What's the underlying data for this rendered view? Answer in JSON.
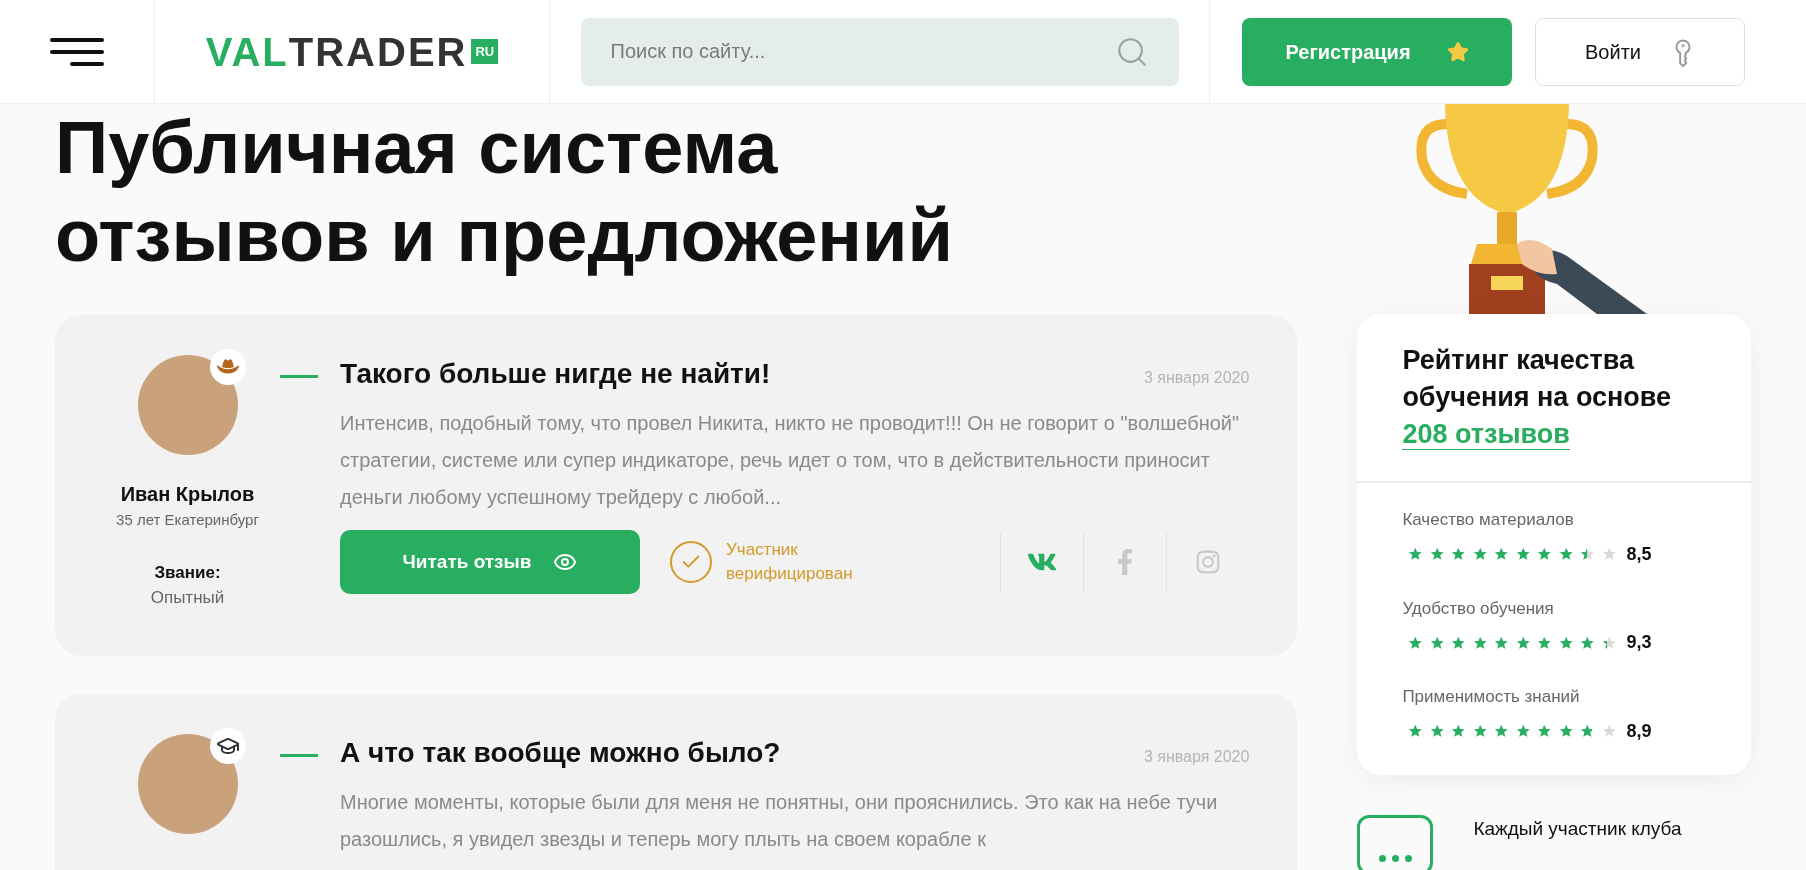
{
  "header": {
    "logo": {
      "part_1": "VAL",
      "part_2": "TRADER",
      "badge": "RU"
    },
    "search": {
      "placeholder": "Поиск по сайту..."
    },
    "register_button": "Регистрация",
    "login_button": "Войти"
  },
  "page_title": "Публичная система отзывов и предложений",
  "reviews": [
    {
      "author": "Иван Крылов",
      "meta": "35 лет Екатеринбург",
      "rank_label": "Звание:",
      "rank": "Опытный",
      "badge": {
        "kind": "hat"
      },
      "title": "Такого больше нигде не найти!",
      "date": "3 января 2020",
      "text": "Интенсив, подобный тому, что провел Никита, никто не проводит!!! Он не говорит о \"волшебной\" стратегии, системе или супер индикаторе, речь идет о том, что в действительности приносит деньги любому успешному трейдеру с любой...",
      "read_button": "Читать отзыв",
      "verified": "Участник верифицирован",
      "socials": [
        {
          "kind": "vk",
          "selected": true
        },
        {
          "kind": "facebook",
          "selected": false
        },
        {
          "kind": "instagram",
          "selected": false
        }
      ]
    },
    {
      "badge": {
        "kind": "cap"
      },
      "title": "А что так вообще можно было?",
      "date": "3 января 2020",
      "text": "Многие моменты, которые были для меня не понятны, они прояснились. Это как на небе тучи разошлись, я увидел звезды и теперь могу плыть на своем корабле к"
    }
  ],
  "rating": {
    "heading": "Рейтинг качества обучения на основе",
    "link": "208 отзывов",
    "criteria": [
      {
        "label": "Качество материалов",
        "stars": 8.5,
        "score": "8,5"
      },
      {
        "label": "Удобство обучения",
        "stars": 9.3,
        "score": "9,3"
      },
      {
        "label": "Применимость знаний",
        "stars": 8.9,
        "score": "8,9"
      }
    ]
  },
  "club": {
    "text": "Каждый участник клуба"
  }
}
